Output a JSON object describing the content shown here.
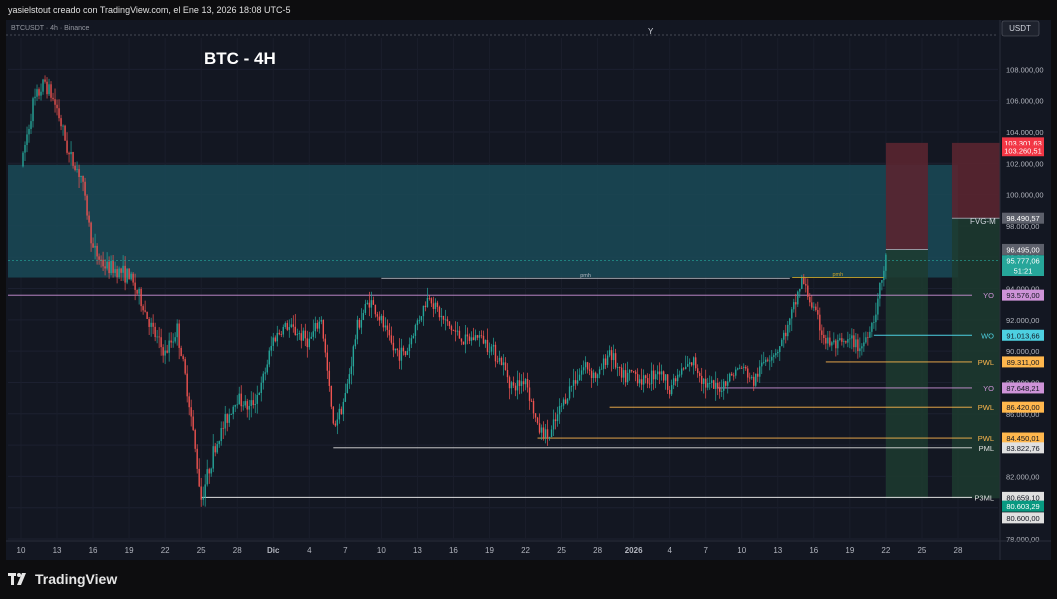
{
  "header": {
    "caption": "yasielstout creado con TradingView.com, el Ene 13, 2026 18:08 UTC-5"
  },
  "symbol_label": "BTCUSDT · 4h · Binance",
  "currency_label": "USDT",
  "crosshair_marker": "Y",
  "footer": {
    "brand": "TradingView",
    "logo_icon": "tradingview-logo-icon"
  },
  "colors": {
    "bull": "#26a69a",
    "bear": "#ef5350",
    "fvg_zone": "#1a4a57",
    "stop_zone": "#5a2530",
    "target_zone": "#1d3b2f"
  },
  "chart_data": {
    "type": "candlestick",
    "title": "BTC - 4H",
    "ylim": [
      78000,
      110000
    ],
    "y_ticks": [
      "78.000,00",
      "80.000,00",
      "82.000,00",
      "84.000,00",
      "86.000,00",
      "88.000,00",
      "90.000,00",
      "92.000,00",
      "94.000,00",
      "96.000,00",
      "98.000,00",
      "100.000,00",
      "102.000,00",
      "104.000,00",
      "106.000,00",
      "108.000,00"
    ],
    "x_ticks": [
      "10",
      "13",
      "16",
      "19",
      "22",
      "25",
      "28",
      "Dic",
      "4",
      "7",
      "10",
      "13",
      "16",
      "19",
      "22",
      "25",
      "28",
      "2026",
      "4",
      "7",
      "10",
      "13",
      "16",
      "19",
      "22",
      "25",
      "28"
    ],
    "price_path": [
      [
        0,
        101800
      ],
      [
        1,
        105800
      ],
      [
        2,
        107200
      ],
      [
        3,
        105500
      ],
      [
        4,
        102500
      ],
      [
        5,
        101200
      ],
      [
        6,
        96500
      ],
      [
        7,
        95400
      ],
      [
        8,
        95200
      ],
      [
        9,
        94800
      ],
      [
        10,
        93200
      ],
      [
        11,
        91200
      ],
      [
        12,
        89800
      ],
      [
        13,
        91400
      ],
      [
        14,
        86800
      ],
      [
        15,
        80600
      ],
      [
        16,
        83500
      ],
      [
        17,
        85500
      ],
      [
        18,
        87100
      ],
      [
        19,
        86300
      ],
      [
        20,
        87700
      ],
      [
        21,
        90800
      ],
      [
        22,
        91600
      ],
      [
        23,
        91200
      ],
      [
        24,
        90600
      ],
      [
        25,
        92100
      ],
      [
        26,
        85200
      ],
      [
        27,
        87100
      ],
      [
        28,
        91600
      ],
      [
        29,
        93300
      ],
      [
        30,
        91900
      ],
      [
        31,
        90100
      ],
      [
        32,
        89800
      ],
      [
        33,
        91900
      ],
      [
        34,
        93600
      ],
      [
        35,
        92100
      ],
      [
        36,
        91300
      ],
      [
        37,
        90600
      ],
      [
        38,
        91000
      ],
      [
        39,
        90400
      ],
      [
        40,
        89300
      ],
      [
        41,
        87600
      ],
      [
        42,
        88300
      ],
      [
        43,
        85100
      ],
      [
        44,
        84500
      ],
      [
        45,
        86500
      ],
      [
        46,
        88100
      ],
      [
        47,
        89100
      ],
      [
        48,
        88300
      ],
      [
        49,
        90100
      ],
      [
        50,
        88200
      ],
      [
        51,
        88600
      ],
      [
        52,
        88000
      ],
      [
        53,
        88900
      ],
      [
        54,
        87700
      ],
      [
        55,
        88700
      ],
      [
        56,
        89300
      ],
      [
        57,
        87900
      ],
      [
        58,
        87500
      ],
      [
        59,
        88400
      ],
      [
        60,
        89000
      ],
      [
        61,
        88000
      ],
      [
        62,
        89600
      ],
      [
        63,
        90100
      ],
      [
        64,
        91800
      ],
      [
        65,
        94600
      ],
      [
        66,
        92600
      ],
      [
        67,
        90600
      ],
      [
        68,
        90300
      ],
      [
        69,
        90600
      ],
      [
        70,
        90300
      ],
      [
        71,
        92100
      ],
      [
        72,
        95800
      ]
    ],
    "zones": [
      {
        "name": "fvg",
        "start": 0,
        "end": 78,
        "low": 94700,
        "high": 101900
      },
      {
        "name": "stop-1",
        "start": 72,
        "end": 75.5,
        "low": 96490,
        "high": 103300
      },
      {
        "name": "target-1",
        "start": 72,
        "end": 75.5,
        "low": 80600,
        "high": 96490
      },
      {
        "name": "stop-2",
        "start": 77.5,
        "end": 81.5,
        "low": 98490,
        "high": 103300
      },
      {
        "name": "target-2",
        "start": 77.5,
        "end": 81.5,
        "low": 80600,
        "high": 98490
      }
    ],
    "annotations": [
      {
        "label": "pmh",
        "price": 94650,
        "start": 30,
        "end": 64,
        "color": "#b2b5be"
      },
      {
        "label": "pmh",
        "price": 94700,
        "start": 64.2,
        "end": 71.8,
        "color": "#c9a227"
      },
      {
        "label": "FVG-M",
        "price": 98300,
        "x": 79
      }
    ],
    "levels": [
      {
        "label": "YO",
        "price": 93576,
        "value": "93.576,00",
        "start": 0,
        "color": "#ce93d8"
      },
      {
        "label": "WO",
        "price": 91013.66,
        "value": "91.013,66",
        "start": 71,
        "color": "#4dd0e1"
      },
      {
        "label": "PWL",
        "price": 89311,
        "value": "89.311,00",
        "start": 67,
        "color": "#ffb74d"
      },
      {
        "label": "YO",
        "price": 87648.21,
        "value": "87.648,21",
        "start": 58,
        "color": "#ce93d8"
      },
      {
        "label": "PWL",
        "price": 86420,
        "value": "86.420,00",
        "start": 49,
        "color": "#ffb74d"
      },
      {
        "label": "PWL",
        "price": 84450.01,
        "value": "84.450,01",
        "start": 43,
        "color": "#ffb74d"
      },
      {
        "label": "PML",
        "price": 83822.76,
        "value": "83.822,76",
        "start": 26,
        "color": "#e0e0e0"
      },
      {
        "label": "P3ML",
        "price": 80659.1,
        "value": "80.659,10",
        "start": 15,
        "color": "#e0e0e0"
      }
    ],
    "price_tags": [
      {
        "value": "103.301,63",
        "price": 103301.63,
        "bg": "#f23645",
        "fg": "#ffffff"
      },
      {
        "value": "103.260,51",
        "price": 102800,
        "bg": "#f23645",
        "fg": "#ffffff"
      },
      {
        "value": "98.490,57",
        "price": 98490.57,
        "bg": "#5d606b",
        "fg": "#ffffff"
      },
      {
        "value": "96.495,00",
        "price": 96495,
        "bg": "#5d606b",
        "fg": "#ffffff"
      },
      {
        "value": "95.777,06",
        "price": 95777.06,
        "bg": "#26a69a",
        "fg": "#ffffff"
      },
      {
        "value": "51:21",
        "price": 95150,
        "bg": "#26a69a",
        "fg": "#ffffff"
      },
      {
        "value": "80.603,29",
        "price": 80100,
        "bg": "#089981",
        "fg": "#ffffff"
      },
      {
        "value": "80.600,00",
        "price": 79350,
        "bg": "#e0e0e0",
        "fg": "#131722"
      }
    ]
  }
}
